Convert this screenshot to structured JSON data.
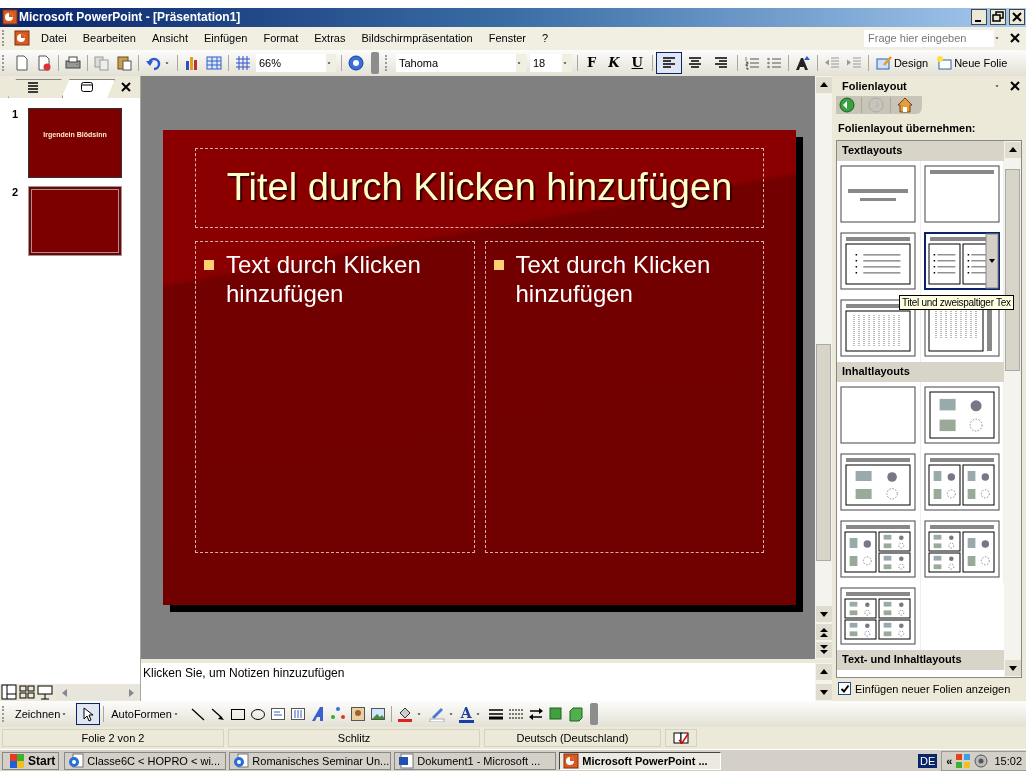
{
  "window": {
    "title": "Microsoft PowerPoint - [Präsentation1]"
  },
  "menu": [
    {
      "label": "Datei"
    },
    {
      "label": "Bearbeiten"
    },
    {
      "label": "Ansicht"
    },
    {
      "label": "Einfügen"
    },
    {
      "label": "Format"
    },
    {
      "label": "Extras"
    },
    {
      "label": "Bildschirmpräsentation"
    },
    {
      "label": "Fenster"
    },
    {
      "label": "?"
    }
  ],
  "help_field": {
    "placeholder": "Frage hier eingeben"
  },
  "standard_toolbar": {
    "zoom": "66%"
  },
  "formatting_toolbar": {
    "font": "Tahoma",
    "size": "18",
    "styles": [
      {
        "label": "F",
        "kind": "bold"
      },
      {
        "label": "K",
        "kind": "italic"
      },
      {
        "label": "U",
        "kind": "underline"
      }
    ],
    "alignments": [
      {
        "kind": "left",
        "selected": true
      },
      {
        "kind": "center",
        "selected": false
      },
      {
        "kind": "right",
        "selected": false
      }
    ],
    "buttons": [
      {
        "label": "Design",
        "kind": "design"
      },
      {
        "label": "Neue Folie",
        "kind": "new-slide"
      }
    ]
  },
  "slides_panel": {
    "tabs": [
      {
        "kind": "outline",
        "selected": false
      },
      {
        "kind": "slides",
        "selected": true
      }
    ],
    "slides": [
      {
        "number": "1",
        "title": "Irgendein Blödsinn",
        "selected": false
      },
      {
        "number": "2",
        "selected": true
      }
    ]
  },
  "slide": {
    "title": "Titel durch Klicken hinzufügen",
    "columns": [
      {
        "text": "Text durch Klicken hinzufügen"
      },
      {
        "text": "Text durch Klicken hinzufügen"
      }
    ]
  },
  "notes": {
    "placeholder": "Klicken Sie, um Notizen hinzuzufügen"
  },
  "task_pane": {
    "title": "Folienlayout",
    "heading": "Folienlayout übernehmen:",
    "sections": [
      {
        "title": "Textlayouts",
        "layouts": [
          {
            "kind": "title",
            "selected": false
          },
          {
            "kind": "title-only",
            "selected": false
          },
          {
            "kind": "title-text",
            "selected": false
          },
          {
            "kind": "title-two-text",
            "selected": true
          },
          {
            "kind": "title-vertical-text",
            "selected": false
          },
          {
            "kind": "vertical",
            "selected": false
          }
        ]
      },
      {
        "title": "Inhaltlayouts",
        "layouts": [
          {
            "kind": "blank",
            "selected": false
          },
          {
            "kind": "content",
            "selected": false
          },
          {
            "kind": "title-content",
            "selected": false
          },
          {
            "kind": "title-two-content",
            "selected": false
          },
          {
            "kind": "title-content-two",
            "selected": false
          },
          {
            "kind": "title-two-content-big",
            "selected": false
          },
          {
            "kind": "title-four-content",
            "selected": false
          }
        ]
      },
      {
        "title": "Text- und Inhaltlayouts"
      }
    ],
    "tooltip": "Titel und zweispaltiger Tex",
    "show_on_insert": {
      "label": "Einfügen neuer Folien anzeigen",
      "checked": true
    }
  },
  "drawing_toolbar": {
    "buttons": [
      {
        "label": "Zeichnen"
      },
      {
        "label": "AutoFormen"
      }
    ],
    "font_color": "A"
  },
  "status_bar": [
    {
      "text": "Folie 2 von 2"
    },
    {
      "text": "Schlitz"
    },
    {
      "text": "Deutsch (Deutschland)"
    }
  ],
  "taskbar": {
    "start": "Start",
    "items": [
      {
        "label": "Classe6C < HOPRO < wi...",
        "kind": "browser",
        "selected": false
      },
      {
        "label": "Romanisches Seminar Un...",
        "kind": "browser",
        "selected": false
      },
      {
        "label": "Dokument1 - Microsoft ...",
        "kind": "word",
        "selected": false
      },
      {
        "label": "Microsoft PowerPoint ...",
        "kind": "powerpoint",
        "selected": true
      }
    ],
    "language": "DE",
    "tray_expand": "«",
    "clock": "15:02"
  }
}
